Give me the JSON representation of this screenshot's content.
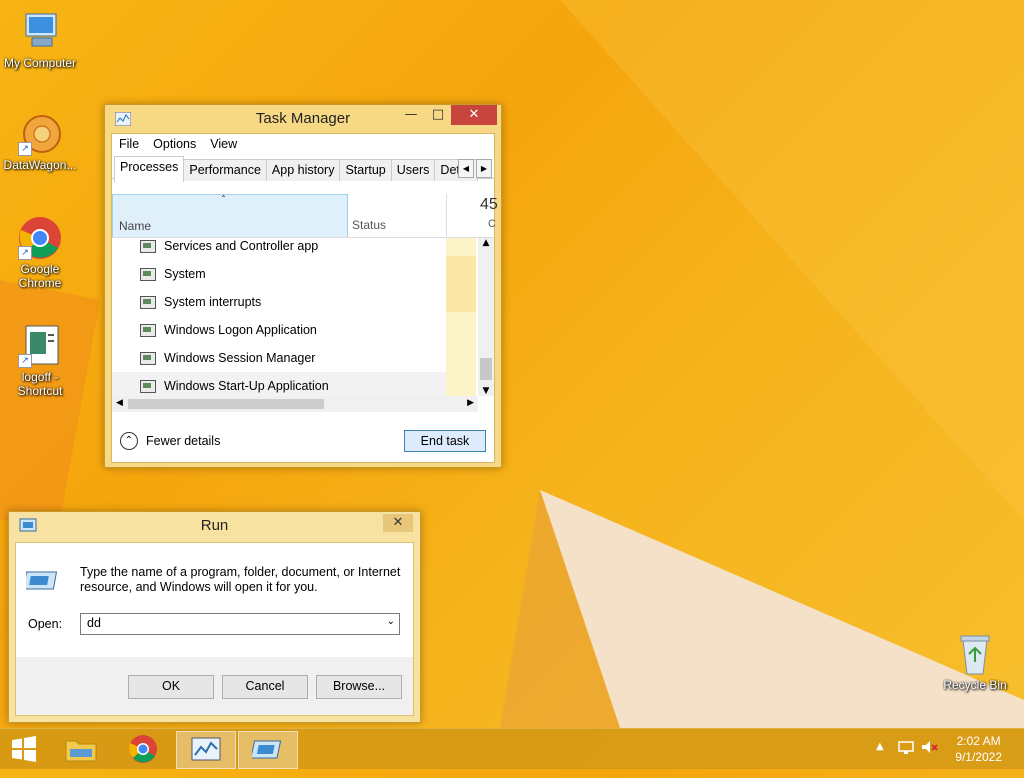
{
  "desktop": {
    "icons": [
      {
        "label": "My Computer"
      },
      {
        "label": "DataWagon..."
      },
      {
        "label": "Google Chrome"
      },
      {
        "label": "logoff - Shortcut"
      },
      {
        "label": "Recycle Bin"
      }
    ]
  },
  "task_manager": {
    "title": "Task Manager",
    "menu": [
      "File",
      "Options",
      "View"
    ],
    "tabs": [
      "Processes",
      "Performance",
      "App history",
      "Startup",
      "Users",
      "Detail"
    ],
    "active_tab": "Processes",
    "columns": {
      "name": "Name",
      "status": "Status",
      "cpu_value": "45",
      "cpu_sub": "C"
    },
    "processes": [
      "Services and Controller app",
      "System",
      "System interrupts",
      "Windows Logon Application",
      "Windows Session Manager",
      "Windows Start-Up Application"
    ],
    "fewer_details": "Fewer details",
    "end_task": "End task"
  },
  "run_dialog": {
    "title": "Run",
    "description": "Type the name of a program, folder, document, or Internet resource, and Windows will open it for you.",
    "open_label": "Open:",
    "open_value": "dd",
    "ok": "OK",
    "cancel": "Cancel",
    "browse": "Browse..."
  },
  "taskbar": {
    "time": "2:02 AM",
    "date": "9/1/2022",
    "items": [
      "start-icon",
      "file-explorer-icon",
      "chrome-icon",
      "task-manager-icon",
      "run-icon"
    ]
  }
}
